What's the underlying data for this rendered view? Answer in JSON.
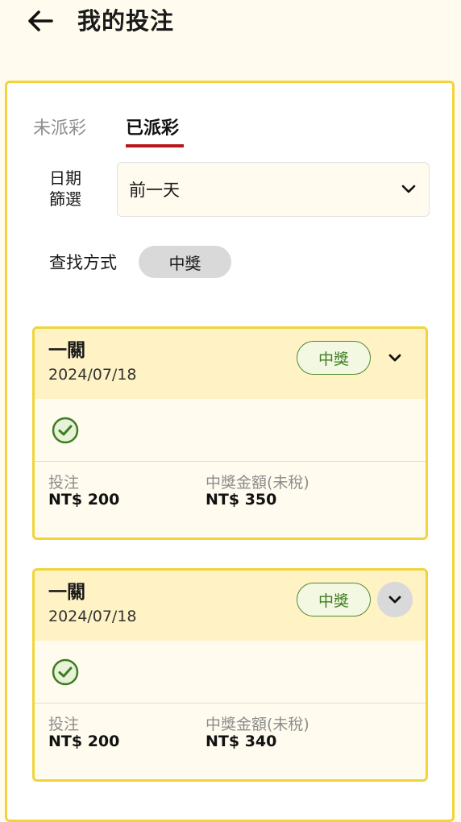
{
  "header": {
    "title": "我的投注",
    "back_icon": "arrow-left-icon"
  },
  "tabs": [
    {
      "label": "未派彩",
      "active": false
    },
    {
      "label": "已派彩",
      "active": true
    }
  ],
  "filter": {
    "date_label": "日期篩選",
    "date_value": "前一天",
    "search_label": "查找方式",
    "search_chip": "中獎"
  },
  "bets": [
    {
      "type": "一關",
      "date": "2024/07/18",
      "status": "中獎",
      "stake_label": "投注",
      "stake_value": "NT$ 200",
      "payout_label": "中獎金額(未稅)",
      "payout_value": "NT$ 350"
    },
    {
      "type": "一關",
      "date": "2024/07/18",
      "status": "中獎",
      "stake_label": "投注",
      "stake_value": "NT$ 200",
      "payout_label": "中獎金額(未稅)",
      "payout_value": "NT$ 340"
    }
  ],
  "colors": {
    "background": "#fffbee",
    "accent_border": "#f1d43c",
    "active_tab_underline": "#b8161c",
    "win_green": "#4f8a2f"
  }
}
